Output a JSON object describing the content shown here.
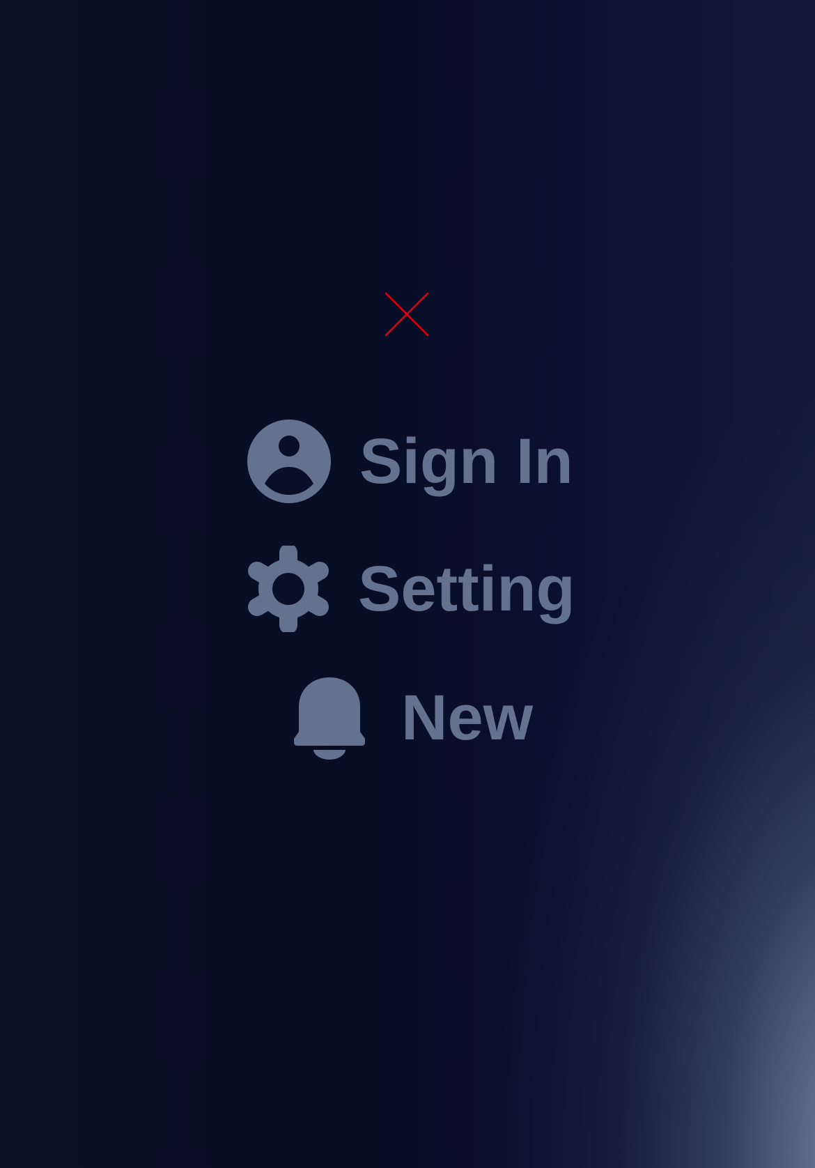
{
  "colors": {
    "icon_text": "#64728f",
    "close_stroke": "#e3000b"
  },
  "close": {
    "icon": "close-icon"
  },
  "menu": {
    "items": [
      {
        "label": "Sign In",
        "icon": "user-circle-icon"
      },
      {
        "label": "Setting",
        "icon": "gear-icon"
      },
      {
        "label": "New",
        "icon": "bell-icon"
      }
    ]
  }
}
